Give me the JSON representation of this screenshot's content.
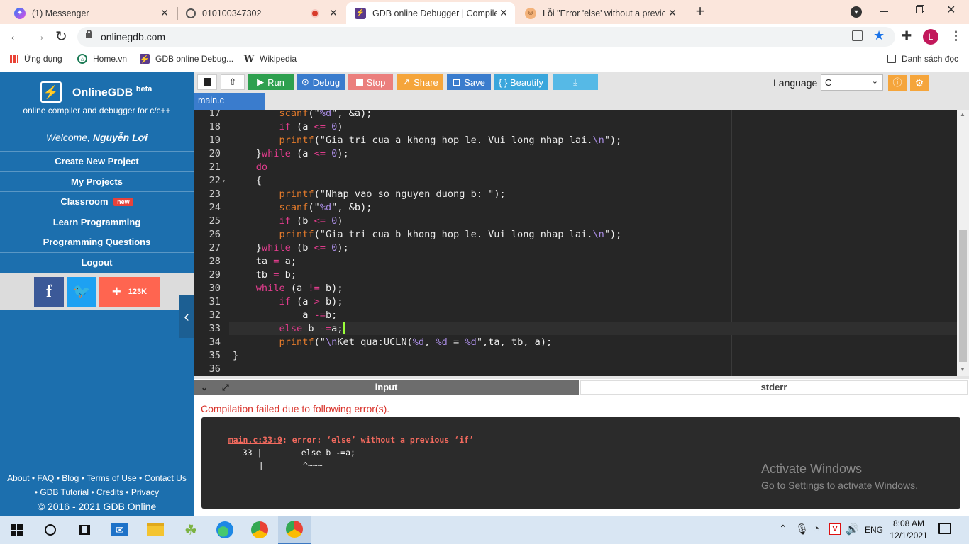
{
  "browser": {
    "tabs": [
      {
        "title": "(1) Messenger",
        "active": false
      },
      {
        "title": "010100347302",
        "active": false
      },
      {
        "title": "GDB online Debugger | Compiler",
        "active": true
      },
      {
        "title": "Lỗi \"Error 'else' without a previou",
        "active": false
      }
    ],
    "new_tab": "+",
    "url": "onlinegdb.com",
    "profile_initial": "L",
    "bookmarks": [
      "Ứng dụng",
      "Home.vn",
      "GDB online Debug...",
      "Wikipedia"
    ],
    "reading_list": "Danh sách đọc"
  },
  "sidebar": {
    "brand": "OnlineGDB",
    "brand_sup": "beta",
    "tagline": "online compiler and debugger for c/c++",
    "welcome": "Welcome,",
    "user": "Nguyễn Lợi",
    "menu": [
      "Create New Project",
      "My Projects",
      "Classroom",
      "Learn Programming",
      "Programming Questions",
      "Logout"
    ],
    "new_badge": "new",
    "share_count": "123K",
    "footer_line1": "About • FAQ • Blog • Terms of Use • Contact Us",
    "footer_line2": "• GDB Tutorial • Credits • Privacy",
    "footer_line3": "© 2016 - 2021 GDB Online"
  },
  "toolbar": {
    "run": "Run",
    "debug": "Debug",
    "stop": "Stop",
    "share": "Share",
    "save": "Save",
    "beautify": "{ } Beautify",
    "language_label": "Language",
    "language_value": "C"
  },
  "file_tab": "main.c",
  "code": [
    {
      "n": "17",
      "t": "        scanf(\"%d\", &a);"
    },
    {
      "n": "18",
      "t": "        if (a <= 0)"
    },
    {
      "n": "19",
      "t": "        printf(\"Gia tri cua a khong hop le. Vui long nhap lai.\\n\");"
    },
    {
      "n": "20",
      "t": "    }while (a <= 0);"
    },
    {
      "n": "21",
      "t": "    do"
    },
    {
      "n": "22",
      "t": "    {"
    },
    {
      "n": "23",
      "t": "        printf(\"Nhap vao so nguyen duong b: \");"
    },
    {
      "n": "24",
      "t": "        scanf(\"%d\", &b);"
    },
    {
      "n": "25",
      "t": "        if (b <= 0)"
    },
    {
      "n": "26",
      "t": "        printf(\"Gia tri cua b khong hop le. Vui long nhap lai.\\n\");"
    },
    {
      "n": "27",
      "t": "    }while (b <= 0);"
    },
    {
      "n": "28",
      "t": "    ta = a;"
    },
    {
      "n": "29",
      "t": "    tb = b;"
    },
    {
      "n": "30",
      "t": "    while (a != b);"
    },
    {
      "n": "31",
      "t": "        if (a > b);"
    },
    {
      "n": "32",
      "t": "            a -=b;"
    },
    {
      "n": "33",
      "t": "        else b -=a;"
    },
    {
      "n": "34",
      "t": "        printf(\"\\nKet qua:UCLN(%d, %d = %d\",ta, tb, a);"
    },
    {
      "n": "35",
      "t": "}"
    },
    {
      "n": "36",
      "t": ""
    }
  ],
  "io": {
    "input_tab": "input",
    "stderr_tab": "stderr",
    "compile_msg": "Compilation failed due to following error(s).",
    "err_loc": "main.c:33:9",
    "err_text": ": error: ‘else’ without a previous ‘if’",
    "err_line_no": "33 |",
    "err_line_code": "        else b -=a;",
    "err_bar": "|",
    "err_caret": "        ^~~~",
    "watermark1": "Activate Windows",
    "watermark2": "Go to Settings to activate Windows."
  },
  "taskbar": {
    "lang": "ENG",
    "time": "8:08 AM",
    "date": "12/1/2021"
  }
}
